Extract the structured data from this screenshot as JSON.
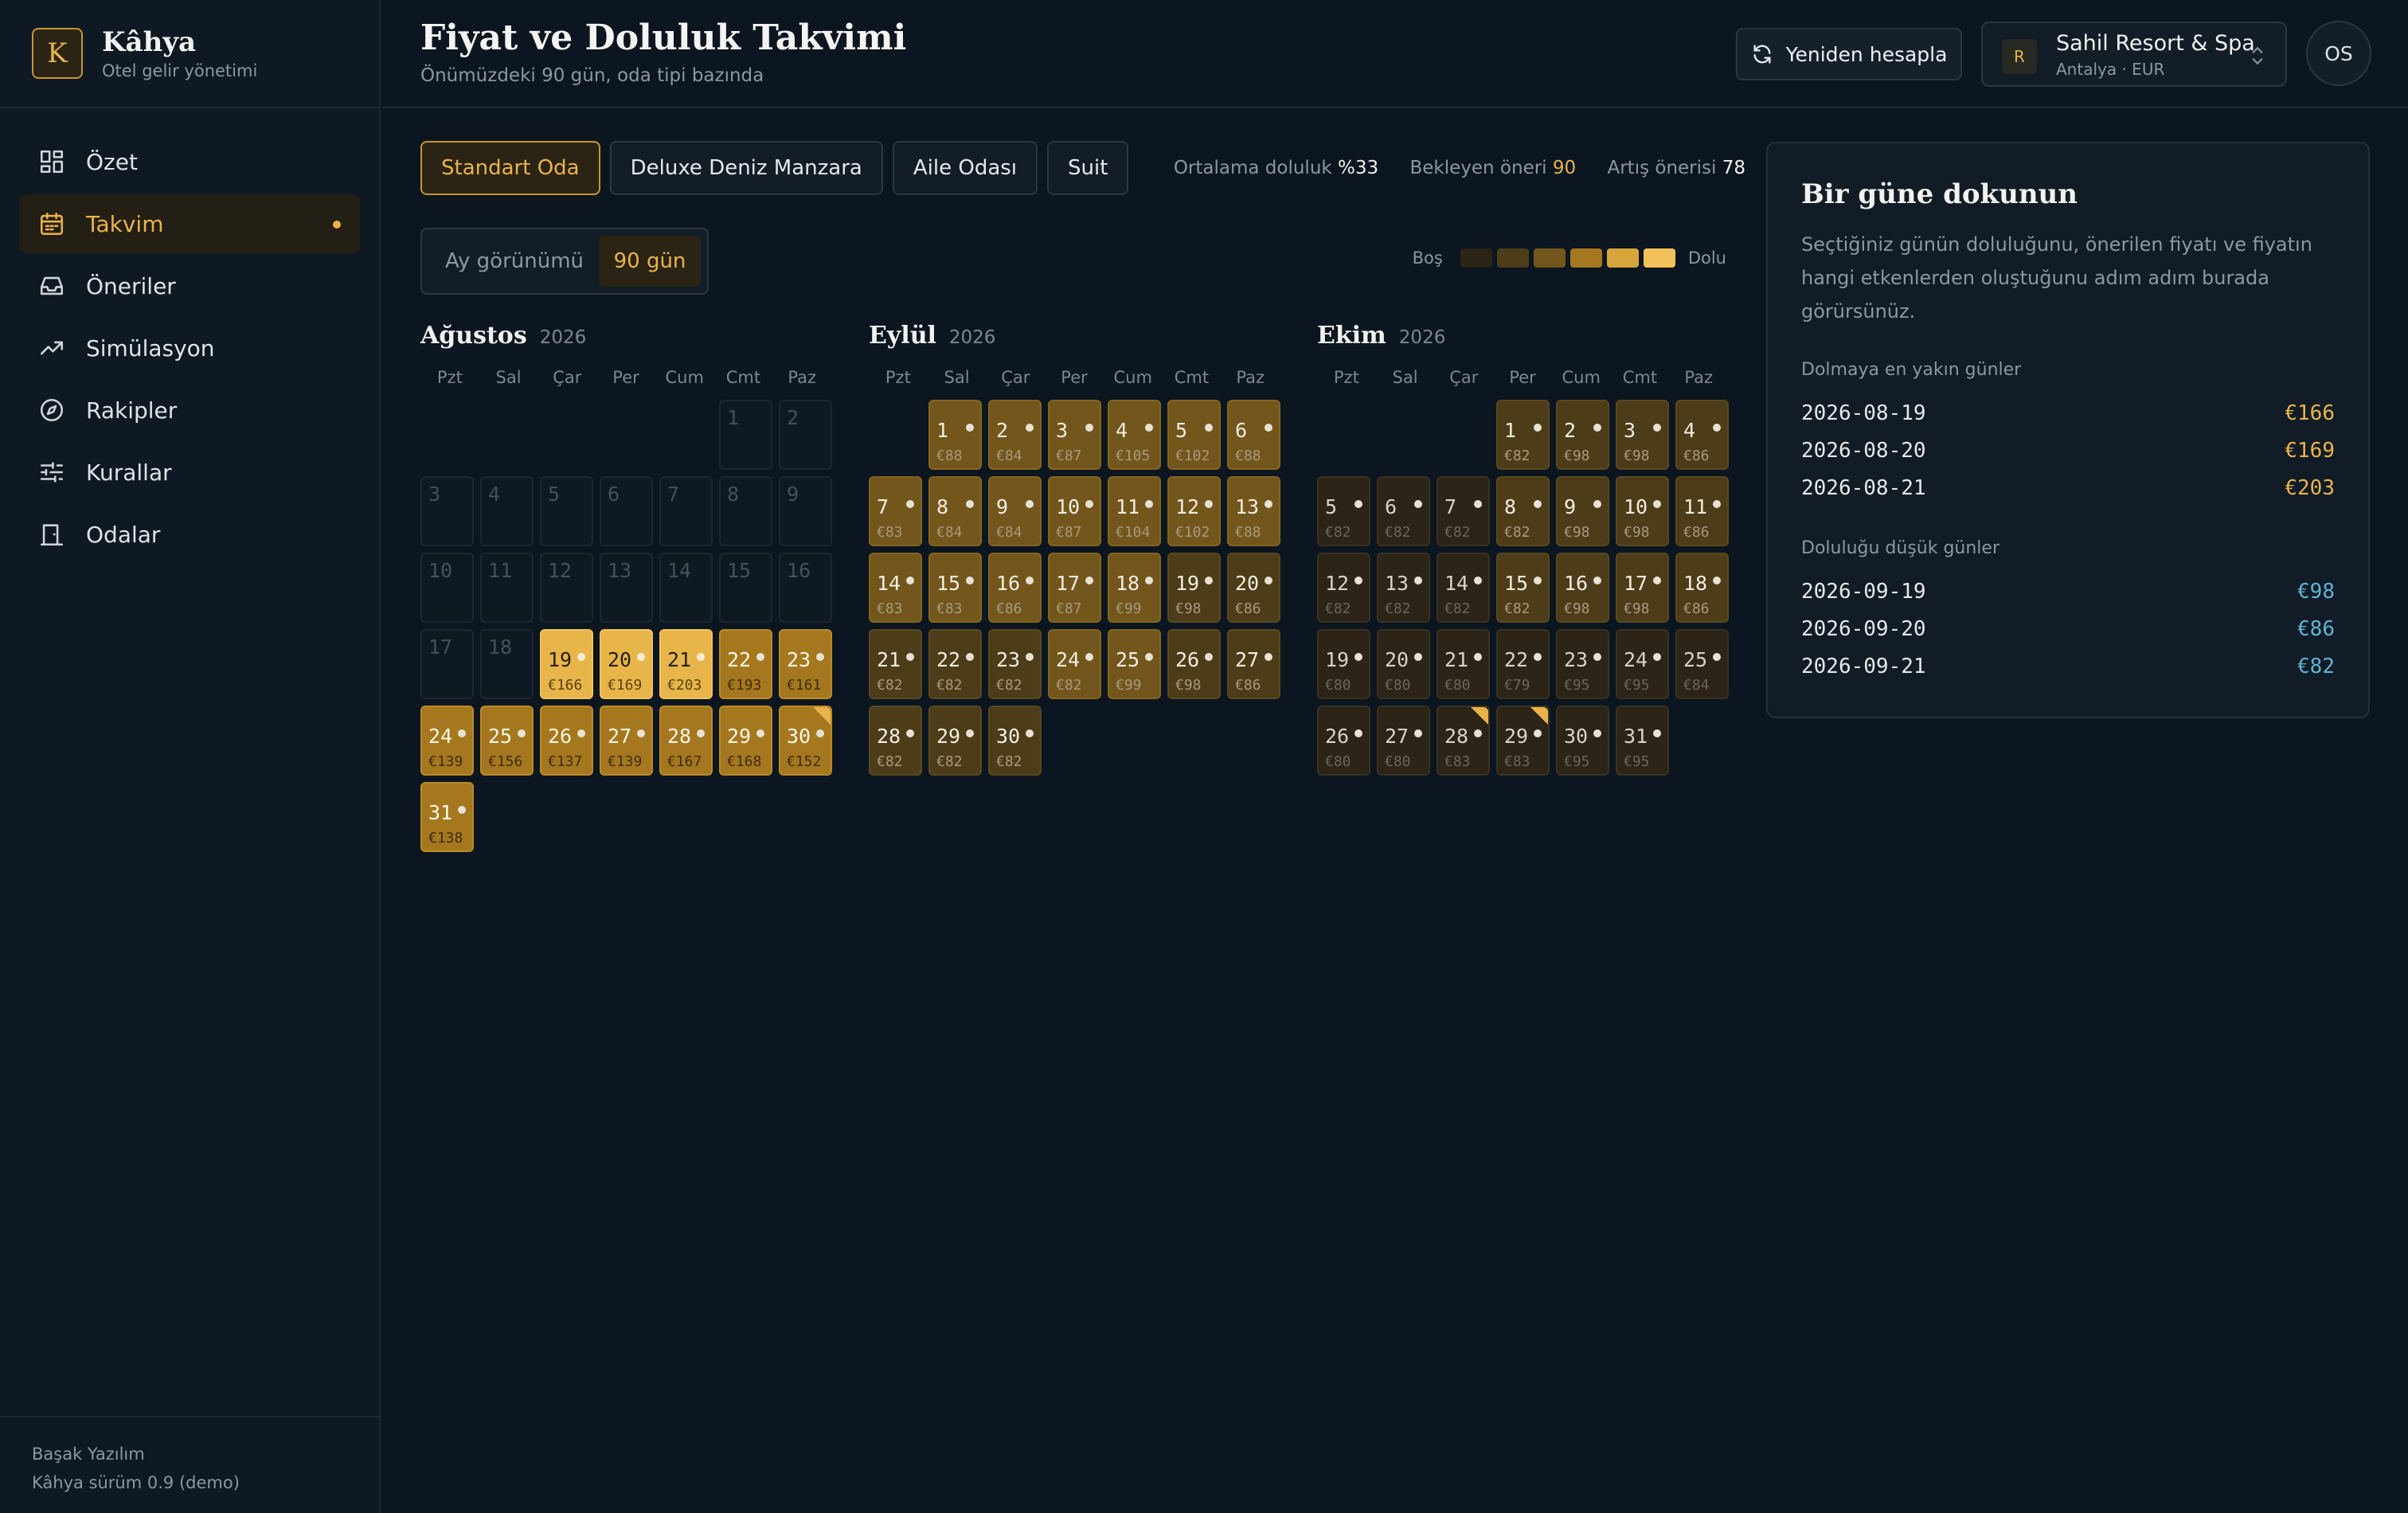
{
  "brand": {
    "logo_letter": "K",
    "name": "Kâhya",
    "subtitle": "Otel gelir yönetimi"
  },
  "nav": [
    {
      "label": "Özet",
      "icon": "grid-icon"
    },
    {
      "label": "Takvim",
      "icon": "calendar-icon",
      "active": true
    },
    {
      "label": "Öneriler",
      "icon": "inbox-icon"
    },
    {
      "label": "Simülasyon",
      "icon": "trend-icon"
    },
    {
      "label": "Rakipler",
      "icon": "compass-icon"
    },
    {
      "label": "Kurallar",
      "icon": "sliders-icon"
    },
    {
      "label": "Odalar",
      "icon": "door-icon"
    }
  ],
  "footer": {
    "company": "Başak Yazılım",
    "version": "Kâhya sürüm 0.9 (demo)"
  },
  "header": {
    "title": "Fiyat ve Doluluk Takvimi",
    "subtitle": "Önümüzdeki 90 gün, oda tipi bazında",
    "recalc_label": "Yeniden hesapla",
    "hotel": {
      "avatar": "R",
      "name": "Sahil Resort & Spa",
      "sub": "Antalya · EUR"
    },
    "user_initials": "OS"
  },
  "room_tabs": [
    "Standart Oda",
    "Deluxe Deniz Manzara",
    "Aile Odası",
    "Suit"
  ],
  "active_tab": 0,
  "stats": {
    "avg_label": "Ortalama doluluk",
    "avg_value": "%33",
    "pending_label": "Bekleyen öneri",
    "pending_value": "90",
    "increase_label": "Artış önerisi",
    "increase_value": "78"
  },
  "view_toggle": {
    "month": "Ay görünümü",
    "days": "90 gün",
    "active": "days"
  },
  "legend": {
    "empty": "Boş",
    "full": "Dolu",
    "colors": [
      "#2b2417",
      "#4c3c18",
      "#73561b",
      "#a5781f",
      "#d6a53c",
      "#f2c25a"
    ]
  },
  "weekdays": [
    "Pzt",
    "Sal",
    "Çar",
    "Per",
    "Cum",
    "Cmt",
    "Paz"
  ],
  "months": [
    {
      "name": "Ağustos",
      "year": "2026",
      "offset": 5,
      "past_until": 18,
      "days": {
        "19": {
          "p": "€166",
          "l": 5
        },
        "20": {
          "p": "€169",
          "l": 5
        },
        "21": {
          "p": "€203",
          "l": 5
        },
        "22": {
          "p": "€193",
          "l": 4
        },
        "23": {
          "p": "€161",
          "l": 4
        },
        "24": {
          "p": "€139",
          "l": 4
        },
        "25": {
          "p": "€156",
          "l": 4
        },
        "26": {
          "p": "€137",
          "l": 4
        },
        "27": {
          "p": "€139",
          "l": 4
        },
        "28": {
          "p": "€167",
          "l": 4
        },
        "29": {
          "p": "€168",
          "l": 4
        },
        "30": {
          "p": "€152",
          "l": 4,
          "flag": true
        },
        "31": {
          "p": "€138",
          "l": 4
        }
      }
    },
    {
      "name": "Eylül",
      "year": "2026",
      "offset": 1,
      "past_until": 0,
      "days": {
        "1": {
          "p": "€88",
          "l": 3
        },
        "2": {
          "p": "€84",
          "l": 3
        },
        "3": {
          "p": "€87",
          "l": 3
        },
        "4": {
          "p": "€105",
          "l": 3
        },
        "5": {
          "p": "€102",
          "l": 3
        },
        "6": {
          "p": "€88",
          "l": 3
        },
        "7": {
          "p": "€83",
          "l": 3
        },
        "8": {
          "p": "€84",
          "l": 3
        },
        "9": {
          "p": "€84",
          "l": 3
        },
        "10": {
          "p": "€87",
          "l": 3
        },
        "11": {
          "p": "€104",
          "l": 3
        },
        "12": {
          "p": "€102",
          "l": 3
        },
        "13": {
          "p": "€88",
          "l": 3
        },
        "14": {
          "p": "€83",
          "l": 3
        },
        "15": {
          "p": "€83",
          "l": 3
        },
        "16": {
          "p": "€86",
          "l": 3
        },
        "17": {
          "p": "€87",
          "l": 3
        },
        "18": {
          "p": "€99",
          "l": 3
        },
        "19": {
          "p": "€98",
          "l": 2
        },
        "20": {
          "p": "€86",
          "l": 2
        },
        "21": {
          "p": "€82",
          "l": 2
        },
        "22": {
          "p": "€82",
          "l": 2
        },
        "23": {
          "p": "€82",
          "l": 2
        },
        "24": {
          "p": "€82",
          "l": 3
        },
        "25": {
          "p": "€99",
          "l": 3
        },
        "26": {
          "p": "€98",
          "l": 2
        },
        "27": {
          "p": "€86",
          "l": 2
        },
        "28": {
          "p": "€82",
          "l": 2
        },
        "29": {
          "p": "€82",
          "l": 2
        },
        "30": {
          "p": "€82",
          "l": 2
        }
      }
    },
    {
      "name": "Ekim",
      "year": "2026",
      "offset": 3,
      "past_until": 0,
      "days": {
        "1": {
          "p": "€82",
          "l": 2
        },
        "2": {
          "p": "€98",
          "l": 2
        },
        "3": {
          "p": "€98",
          "l": 2
        },
        "4": {
          "p": "€86",
          "l": 2
        },
        "5": {
          "p": "€82",
          "l": 1
        },
        "6": {
          "p": "€82",
          "l": 1
        },
        "7": {
          "p": "€82",
          "l": 1
        },
        "8": {
          "p": "€82",
          "l": 2
        },
        "9": {
          "p": "€98",
          "l": 2
        },
        "10": {
          "p": "€98",
          "l": 2
        },
        "11": {
          "p": "€86",
          "l": 2
        },
        "12": {
          "p": "€82",
          "l": 1
        },
        "13": {
          "p": "€82",
          "l": 1
        },
        "14": {
          "p": "€82",
          "l": 1
        },
        "15": {
          "p": "€82",
          "l": 2
        },
        "16": {
          "p": "€98",
          "l": 2
        },
        "17": {
          "p": "€98",
          "l": 2
        },
        "18": {
          "p": "€86",
          "l": 2
        },
        "19": {
          "p": "€80",
          "l": 1
        },
        "20": {
          "p": "€80",
          "l": 1
        },
        "21": {
          "p": "€80",
          "l": 1
        },
        "22": {
          "p": "€79",
          "l": 1
        },
        "23": {
          "p": "€95",
          "l": 1
        },
        "24": {
          "p": "€95",
          "l": 1
        },
        "25": {
          "p": "€84",
          "l": 1
        },
        "26": {
          "p": "€80",
          "l": 1
        },
        "27": {
          "p": "€80",
          "l": 1
        },
        "28": {
          "p": "€83",
          "l": 1,
          "flag": true
        },
        "29": {
          "p": "€83",
          "l": 1,
          "flag": true
        },
        "30": {
          "p": "€95",
          "l": 1
        },
        "31": {
          "p": "€95",
          "l": 1
        }
      }
    }
  ],
  "panel": {
    "title": "Bir güne dokunun",
    "desc": "Seçtiğiniz günün doluluğunu, önerilen fiyatı ve fiyatın hangi etkenlerden oluştuğunu adım adım burada görürsünüz.",
    "high_title": "Dolmaya en yakın günler",
    "high": [
      {
        "date": "2026-08-19",
        "price": "€166"
      },
      {
        "date": "2026-08-20",
        "price": "€169"
      },
      {
        "date": "2026-08-21",
        "price": "€203"
      }
    ],
    "low_title": "Doluluğu düşük günler",
    "low": [
      {
        "date": "2026-09-19",
        "price": "€98"
      },
      {
        "date": "2026-09-20",
        "price": "€86"
      },
      {
        "date": "2026-09-21",
        "price": "€82"
      }
    ]
  }
}
